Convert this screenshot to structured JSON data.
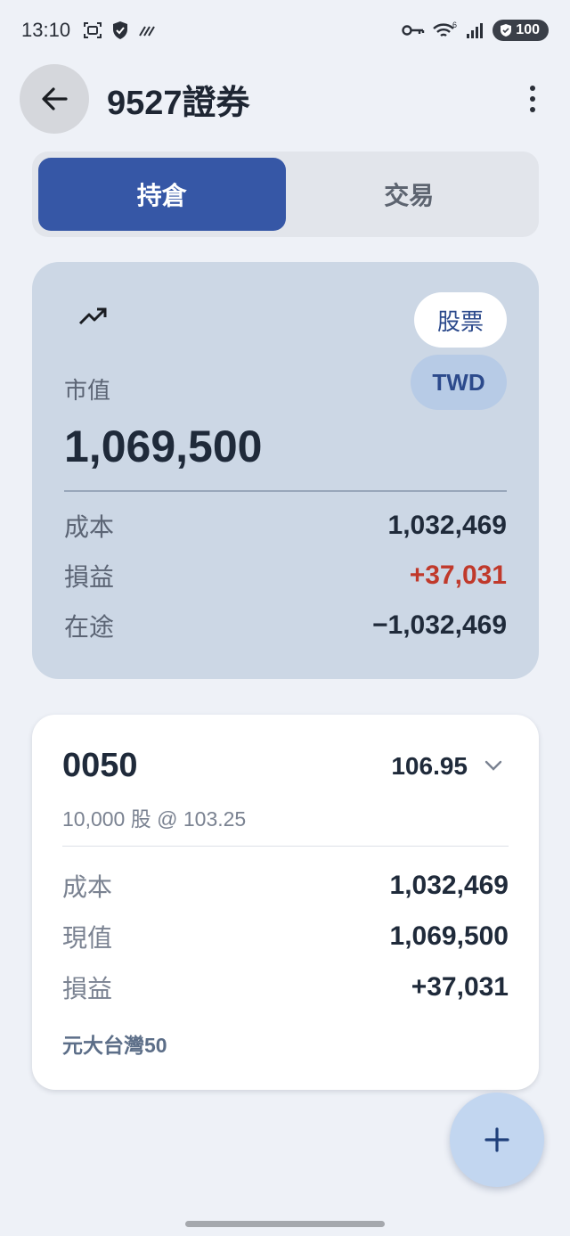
{
  "status_bar": {
    "time": "13:10",
    "battery": "100",
    "wifi_badge": "6"
  },
  "header": {
    "title": "9527證券",
    "back_icon": "arrow-left-icon",
    "menu_icon": "more-vertical-icon"
  },
  "tabs": [
    {
      "label": "持倉",
      "active": true
    },
    {
      "label": "交易",
      "active": false
    }
  ],
  "summary": {
    "trend_icon": "trending-up-icon",
    "asset_type": "股票",
    "currency": "TWD",
    "market_value_label": "市值",
    "market_value": "1,069,500",
    "rows": {
      "cost": {
        "label": "成本",
        "value": "1,032,469"
      },
      "pnl": {
        "label": "損益",
        "value": "+37,031"
      },
      "in_transit": {
        "label": "在途",
        "value": "−1,032,469"
      }
    }
  },
  "holding": {
    "ticker": "0050",
    "price": "106.95",
    "quantity_line": "10,000 股 @ 103.25",
    "rows": {
      "cost": {
        "label": "成本",
        "value": "1,032,469"
      },
      "current_value": {
        "label": "現值",
        "value": "1,069,500"
      },
      "pnl": {
        "label": "損益",
        "value": "+37,031"
      }
    },
    "name": "元大台灣50"
  },
  "fab": {
    "icon": "plus-icon"
  },
  "colors": {
    "primary": "#3657a6",
    "summary_bg": "#ccd7e5",
    "loss_red": "#c0392b",
    "gain_green": "#3e8a3a"
  }
}
